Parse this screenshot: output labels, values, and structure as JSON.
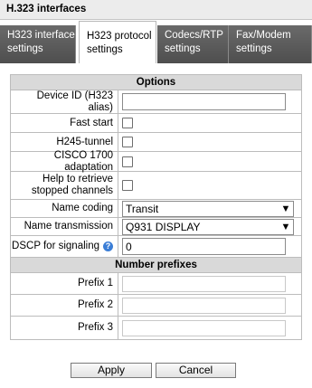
{
  "window": {
    "title": "H.323 interfaces"
  },
  "tabs": [
    {
      "line1": "H323 interface",
      "line2": "settings",
      "active": false
    },
    {
      "line1": "H323 protocol",
      "line2": "settings",
      "active": true
    },
    {
      "line1": "Codecs/RTP",
      "line2": "settings",
      "active": false
    },
    {
      "line1": "Fax/Modem",
      "line2": "settings",
      "active": false
    }
  ],
  "options": {
    "header": "Options",
    "device_id": {
      "label": "Device ID (H323 alias)",
      "value": ""
    },
    "fast_start": {
      "label": "Fast start",
      "checked": false
    },
    "h245_tunnel": {
      "label": "H245-tunnel",
      "checked": false
    },
    "cisco_adaptation": {
      "label": "CISCO 1700 adaptation",
      "checked": false
    },
    "help_retrieve": {
      "label_line1": "Help to retrieve",
      "label_line2": "stopped channels",
      "checked": false
    },
    "name_coding": {
      "label": "Name coding",
      "value": "Transit"
    },
    "name_transmission": {
      "label": "Name transmission",
      "value": "Q931 DISPLAY"
    },
    "dscp": {
      "label": "DSCP for signaling",
      "value": "0",
      "help_icon": "question-icon"
    }
  },
  "prefixes": {
    "header": "Number prefixes",
    "items": [
      {
        "label": "Prefix 1",
        "value": ""
      },
      {
        "label": "Prefix 2",
        "value": ""
      },
      {
        "label": "Prefix 3",
        "value": ""
      }
    ]
  },
  "actions": {
    "apply": "Apply",
    "cancel": "Cancel"
  }
}
